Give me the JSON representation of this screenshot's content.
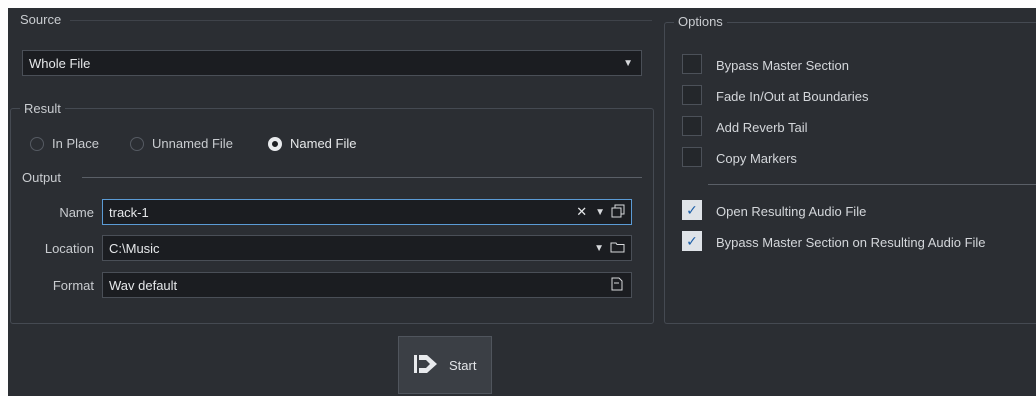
{
  "source": {
    "title": "Source",
    "selected": "Whole File"
  },
  "result": {
    "title": "Result",
    "modes": [
      {
        "label": "In Place",
        "selected": false
      },
      {
        "label": "Unnamed File",
        "selected": false
      },
      {
        "label": "Named File",
        "selected": true
      }
    ],
    "output_title": "Output",
    "name_label": "Name",
    "name_value": "track-1",
    "location_label": "Location",
    "location_value": "C:\\Music",
    "format_label": "Format",
    "format_value": "Wav default"
  },
  "options": {
    "title": "Options",
    "checkboxes": [
      {
        "label": "Bypass Master Section",
        "checked": false
      },
      {
        "label": "Fade In/Out at Boundaries",
        "checked": false
      },
      {
        "label": "Add Reverb Tail",
        "checked": false
      },
      {
        "label": "Copy Markers",
        "checked": false
      },
      {
        "label": "Open Resulting Audio File",
        "checked": true
      },
      {
        "label": "Bypass Master Section on Resulting Audio File",
        "checked": true
      }
    ]
  },
  "start_button": {
    "label": "Start"
  },
  "icons": {
    "clear": "clear-icon",
    "dropdown": "chevron-down-icon",
    "copy": "copy-icon",
    "folder": "folder-icon",
    "format": "document-icon",
    "start": "start-arrow-icon"
  }
}
